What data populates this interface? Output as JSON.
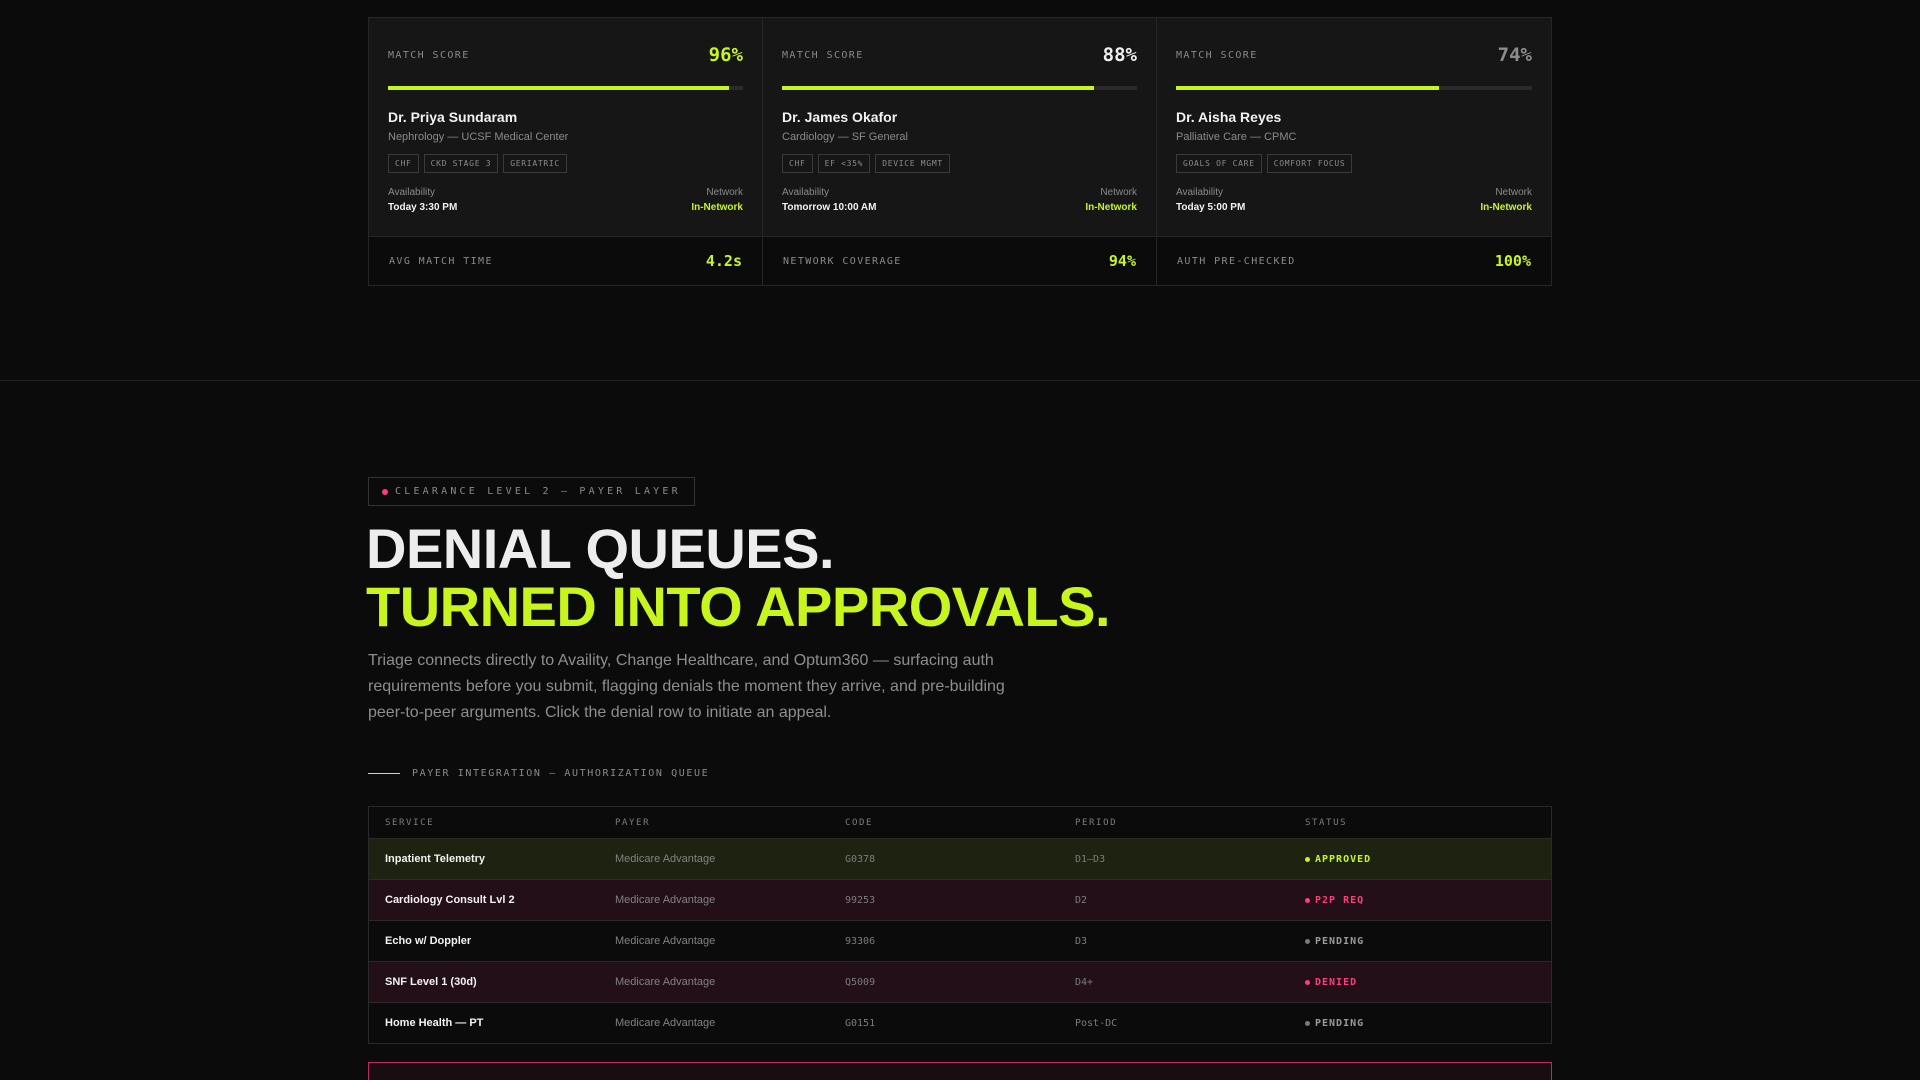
{
  "specialists": {
    "score_label": "MATCH SCORE",
    "availability_label": "Availability",
    "network_label": "Network",
    "cards": [
      {
        "score": "96%",
        "score_fraction": 0.96,
        "name": "Dr. Priya Sundaram",
        "specialty": "Nephrology — UCSF Medical Center",
        "tags": [
          "CHF",
          "CKD STAGE 3",
          "GERIATRIC"
        ],
        "availability": "Today 3:30 PM",
        "network": "In-Network"
      },
      {
        "score": "88%",
        "score_fraction": 0.88,
        "name": "Dr. James Okafor",
        "specialty": "Cardiology — SF General",
        "tags": [
          "CHF",
          "EF <35%",
          "DEVICE MGMT"
        ],
        "availability": "Tomorrow 10:00 AM",
        "network": "In-Network"
      },
      {
        "score": "74%",
        "score_fraction": 0.74,
        "name": "Dr. Aisha Reyes",
        "specialty": "Palliative Care — CPMC",
        "tags": [
          "GOALS OF CARE",
          "COMFORT FOCUS"
        ],
        "availability": "Today 5:00 PM",
        "network": "In-Network"
      }
    ],
    "stats": [
      {
        "label": "AVG MATCH TIME",
        "value": "4.2s"
      },
      {
        "label": "NETWORK COVERAGE",
        "value": "94%"
      },
      {
        "label": "AUTH PRE-CHECKED",
        "value": "100%"
      }
    ]
  },
  "payer_section": {
    "clearance": "CLEARANCE LEVEL 2 — PAYER LAYER",
    "headline_line1": "DENIAL QUEUES.",
    "headline_line2": "TURNED INTO APPROVALS.",
    "description": "Triage connects directly to Availity, Change Healthcare, and Optum360 — surfacing auth requirements before you submit, flagging denials the moment they arrive, and pre-building peer-to-peer arguments. Click the denial row to initiate an appeal.",
    "caption": "PAYER INTEGRATION — AUTHORIZATION QUEUE"
  },
  "queue": {
    "headers": [
      "SERVICE",
      "PAYER",
      "CODE",
      "PERIOD",
      "STATUS"
    ],
    "rows": [
      {
        "service": "Inpatient Telemetry",
        "payer": "Medicare Advantage",
        "code": "G0378",
        "period": "D1–D3",
        "status": "APPROVED"
      },
      {
        "service": "Cardiology Consult Lvl 2",
        "payer": "Medicare Advantage",
        "code": "99253",
        "period": "D2",
        "status": "P2P REQ"
      },
      {
        "service": "Echo w/ Doppler",
        "payer": "Medicare Advantage",
        "code": "93306",
        "period": "D3",
        "status": "PENDING"
      },
      {
        "service": "SNF Level 1 (30d)",
        "payer": "Medicare Advantage",
        "code": "Q5009",
        "period": "D4+",
        "status": "DENIED"
      },
      {
        "service": "Home Health — PT",
        "payer": "Medicare Advantage",
        "code": "G0151",
        "period": "Post-DC",
        "status": "PENDING"
      }
    ]
  },
  "colors": {
    "accent": "#c8f51e",
    "alert": "#ff3d7a",
    "background": "#0b0b0b"
  }
}
